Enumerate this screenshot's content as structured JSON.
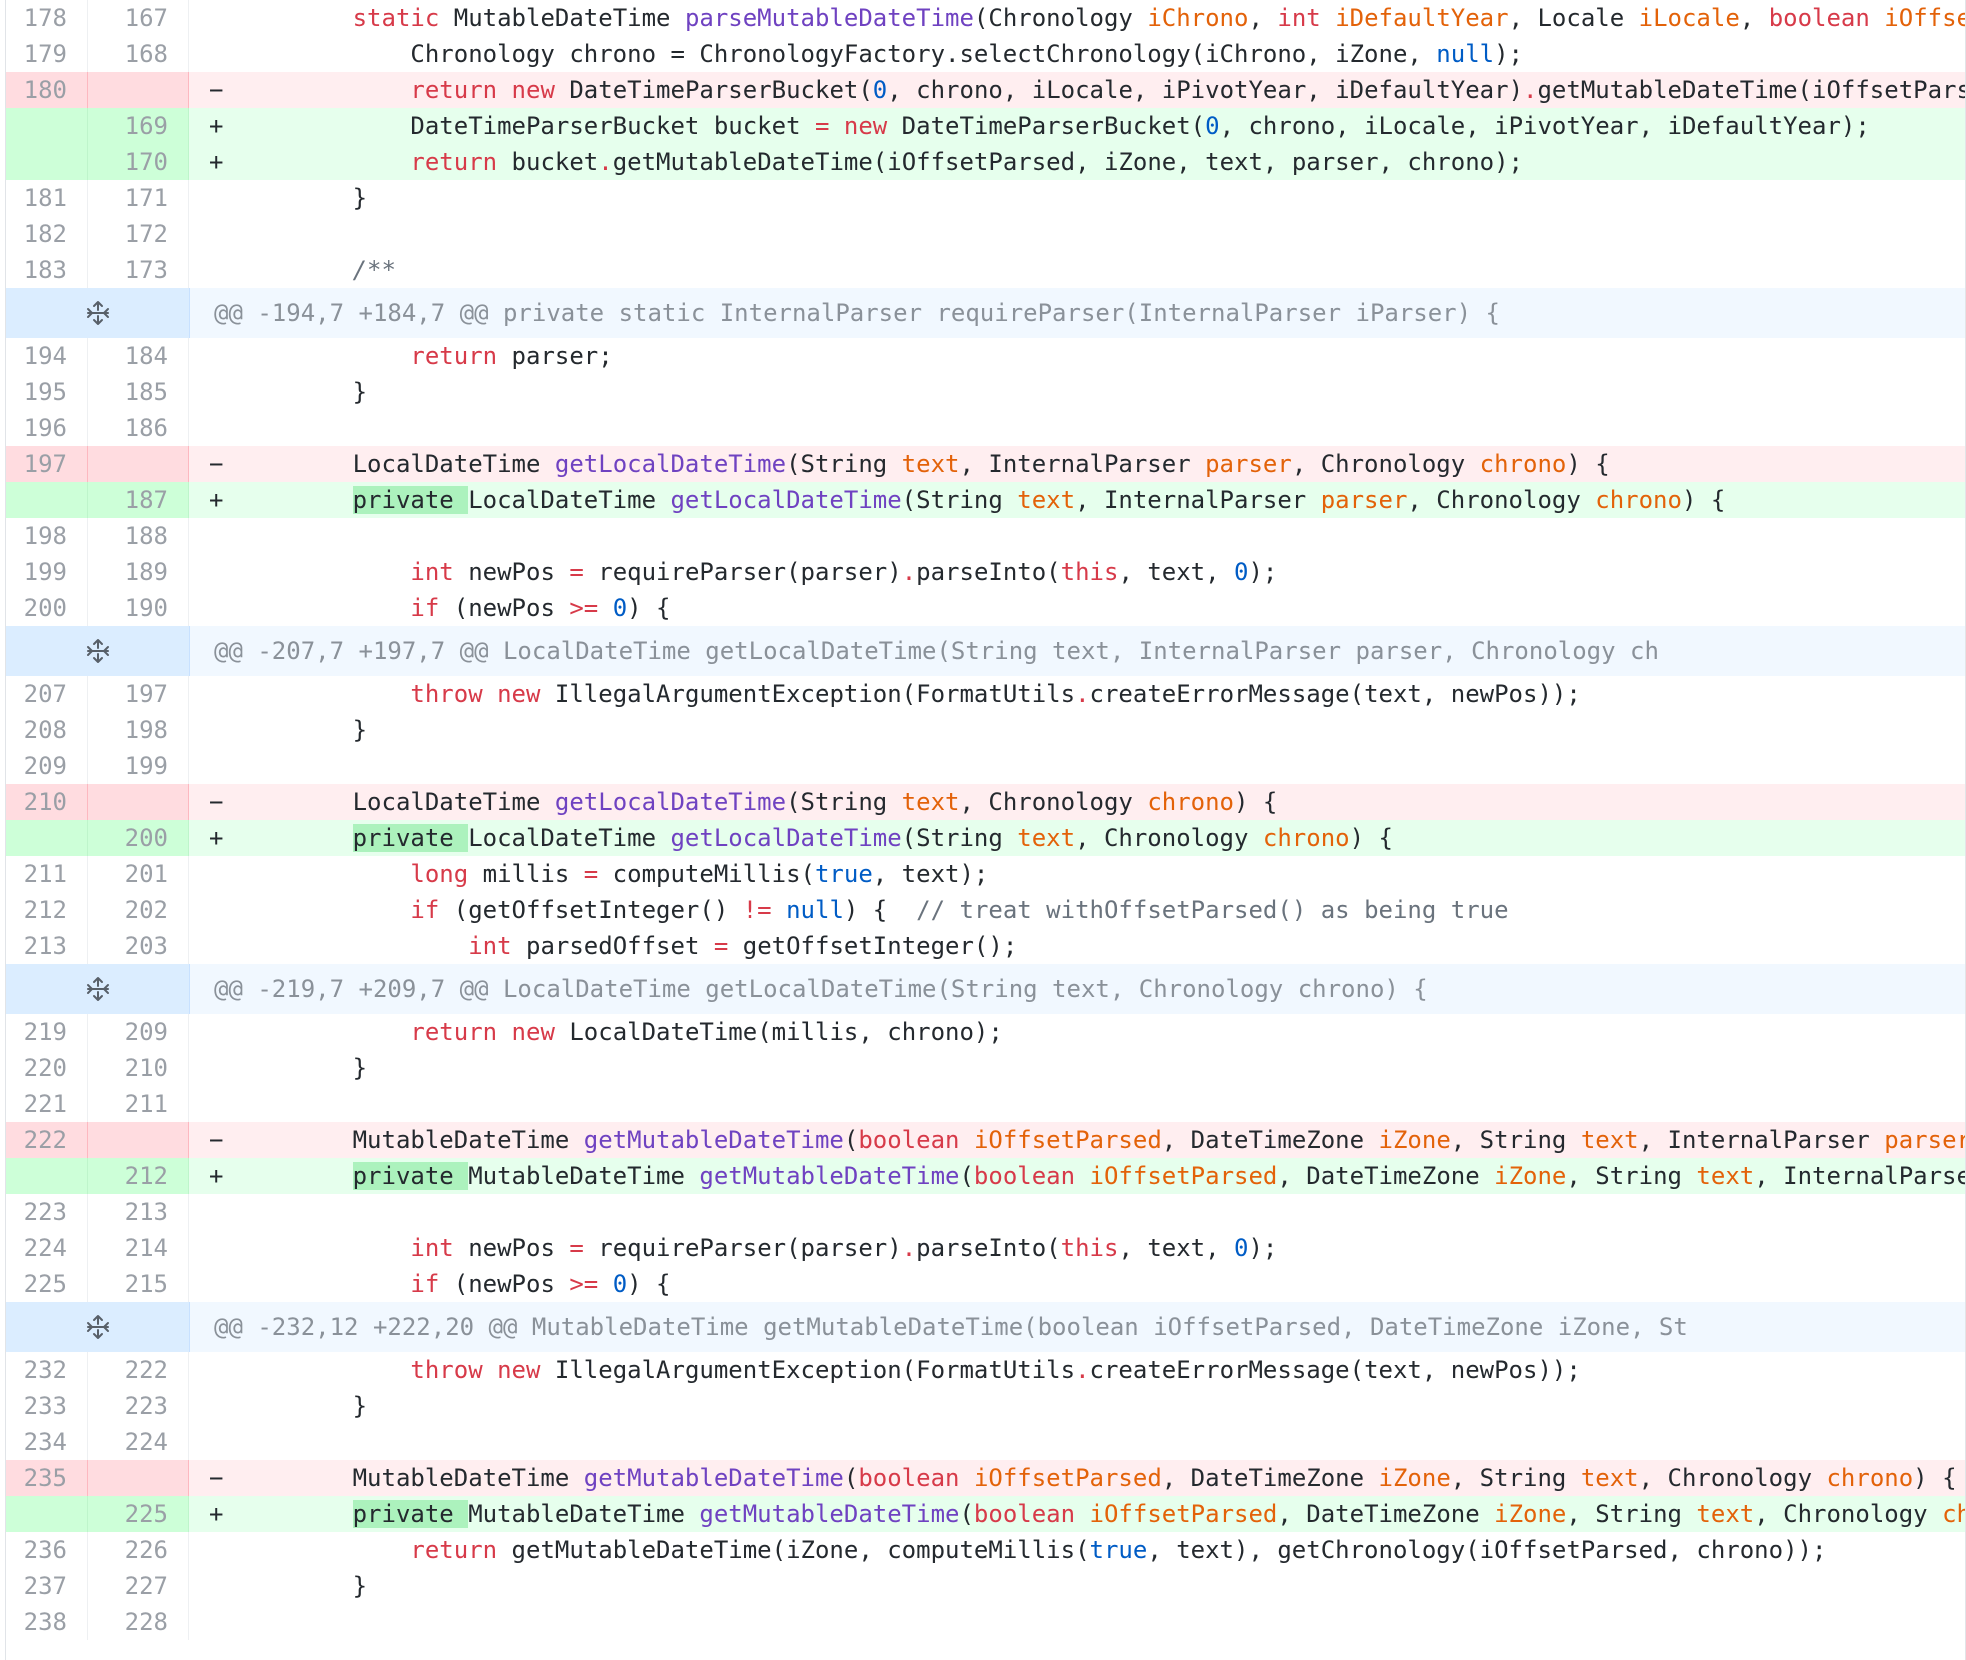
{
  "diff": {
    "rows": [
      {
        "type": "ctx",
        "old": "178",
        "new": "167",
        "code": "        ${kw:static} MutableDateTime ${fn:parseMutableDateTime}(Chronology ${pa:iChrono}, ${kw:int} ${pa:iDefaultYear}, Locale ${pa:iLocale}, ${kw:boolean} ${pa:iOffsetPars}"
      },
      {
        "type": "ctx",
        "old": "179",
        "new": "168",
        "code": "            Chronology chrono = ChronologyFactory.selectChronology(iChrono, iZone, ${cn:null});"
      },
      {
        "type": "del",
        "old": "180",
        "new": "",
        "code": "            ${kw:return} ${kw:new} DateTimeParserBucket(${cn:0}, chrono, iLocale, iPivotYear, iDefaultYear)${kw:.}getMutableDateTime(iOffsetParsed, i"
      },
      {
        "type": "add",
        "old": "",
        "new": "169",
        "code": "            DateTimeParserBucket bucket ${kw:=} ${kw:new} DateTimeParserBucket(${cn:0}, chrono, iLocale, iPivotYear, iDefaultYear);"
      },
      {
        "type": "add",
        "old": "",
        "new": "170",
        "code": "            ${kw:return} bucket${kw:.}getMutableDateTime(iOffsetParsed, iZone, text, parser, chrono);"
      },
      {
        "type": "ctx",
        "old": "181",
        "new": "171",
        "code": "        }"
      },
      {
        "type": "ctx",
        "old": "182",
        "new": "172",
        "code": ""
      },
      {
        "type": "ctx",
        "old": "183",
        "new": "173",
        "code": "        ${cm:/**}"
      },
      {
        "type": "hunk",
        "text": "@@ -194,7 +184,7 @@ private static InternalParser requireParser(InternalParser iParser) {"
      },
      {
        "type": "ctx",
        "old": "194",
        "new": "184",
        "code": "            ${kw:return} parser;"
      },
      {
        "type": "ctx",
        "old": "195",
        "new": "185",
        "code": "        }"
      },
      {
        "type": "ctx",
        "old": "196",
        "new": "186",
        "code": ""
      },
      {
        "type": "del",
        "old": "197",
        "new": "",
        "code": "        LocalDateTime ${fn:getLocalDateTime}(String ${pa:text}, InternalParser ${pa:parser}, Chronology ${pa:chrono}) {"
      },
      {
        "type": "add",
        "old": "",
        "new": "187",
        "code": "        ${hl:private }LocalDateTime ${fn:getLocalDateTime}(String ${pa:text}, InternalParser ${pa:parser}, Chronology ${pa:chrono}) {"
      },
      {
        "type": "ctx",
        "old": "198",
        "new": "188",
        "code": ""
      },
      {
        "type": "ctx",
        "old": "199",
        "new": "189",
        "code": "            ${kw:int} newPos ${kw:=} requireParser(parser)${kw:.}parseInto(${kw:this}, text, ${cn:0});"
      },
      {
        "type": "ctx",
        "old": "200",
        "new": "190",
        "code": "            ${kw:if} (newPos ${kw:>=} ${cn:0}) {"
      },
      {
        "type": "hunk",
        "text": "@@ -207,7 +197,7 @@ LocalDateTime getLocalDateTime(String text, InternalParser parser, Chronology ch"
      },
      {
        "type": "ctx",
        "old": "207",
        "new": "197",
        "code": "            ${kw:throw} ${kw:new} IllegalArgumentException(FormatUtils${kw:.}createErrorMessage(text, newPos));"
      },
      {
        "type": "ctx",
        "old": "208",
        "new": "198",
        "code": "        }"
      },
      {
        "type": "ctx",
        "old": "209",
        "new": "199",
        "code": ""
      },
      {
        "type": "del",
        "old": "210",
        "new": "",
        "code": "        LocalDateTime ${fn:getLocalDateTime}(String ${pa:text}, Chronology ${pa:chrono}) {"
      },
      {
        "type": "add",
        "old": "",
        "new": "200",
        "code": "        ${hl:private }LocalDateTime ${fn:getLocalDateTime}(String ${pa:text}, Chronology ${pa:chrono}) {"
      },
      {
        "type": "ctx",
        "old": "211",
        "new": "201",
        "code": "            ${kw:long} millis ${kw:=} computeMillis(${cn:true}, text);"
      },
      {
        "type": "ctx",
        "old": "212",
        "new": "202",
        "code": "            ${kw:if} (getOffsetInteger() ${kw:!=} ${cn:null}) {  ${cm2:// treat withOffsetParsed() as being true}"
      },
      {
        "type": "ctx",
        "old": "213",
        "new": "203",
        "code": "                ${kw:int} parsedOffset ${kw:=} getOffsetInteger();"
      },
      {
        "type": "hunk",
        "text": "@@ -219,7 +209,7 @@ LocalDateTime getLocalDateTime(String text, Chronology chrono) {"
      },
      {
        "type": "ctx",
        "old": "219",
        "new": "209",
        "code": "            ${kw:return} ${kw:new} LocalDateTime(millis, chrono);"
      },
      {
        "type": "ctx",
        "old": "220",
        "new": "210",
        "code": "        }"
      },
      {
        "type": "ctx",
        "old": "221",
        "new": "211",
        "code": ""
      },
      {
        "type": "del",
        "old": "222",
        "new": "",
        "code": "        MutableDateTime ${fn:getMutableDateTime}(${kw:boolean} ${pa:iOffsetParsed}, DateTimeZone ${pa:iZone}, String ${pa:text}, InternalParser ${pa:parser}, Chr"
      },
      {
        "type": "add",
        "old": "",
        "new": "212",
        "code": "        ${hl:private }MutableDateTime ${fn:getMutableDateTime}(${kw:boolean} ${pa:iOffsetParsed}, DateTimeZone ${pa:iZone}, String ${pa:text}, InternalParser ${pa:par}"
      },
      {
        "type": "ctx",
        "old": "223",
        "new": "213",
        "code": ""
      },
      {
        "type": "ctx",
        "old": "224",
        "new": "214",
        "code": "            ${kw:int} newPos ${kw:=} requireParser(parser)${kw:.}parseInto(${kw:this}, text, ${cn:0});"
      },
      {
        "type": "ctx",
        "old": "225",
        "new": "215",
        "code": "            ${kw:if} (newPos ${kw:>=} ${cn:0}) {"
      },
      {
        "type": "hunk",
        "text": "@@ -232,12 +222,20 @@ MutableDateTime getMutableDateTime(boolean iOffsetParsed, DateTimeZone iZone, St"
      },
      {
        "type": "ctx",
        "old": "232",
        "new": "222",
        "code": "            ${kw:throw} ${kw:new} IllegalArgumentException(FormatUtils${kw:.}createErrorMessage(text, newPos));"
      },
      {
        "type": "ctx",
        "old": "233",
        "new": "223",
        "code": "        }"
      },
      {
        "type": "ctx",
        "old": "234",
        "new": "224",
        "code": ""
      },
      {
        "type": "del",
        "old": "235",
        "new": "",
        "code": "        MutableDateTime ${fn:getMutableDateTime}(${kw:boolean} ${pa:iOffsetParsed}, DateTimeZone ${pa:iZone}, String ${pa:text}, Chronology ${pa:chrono}) {"
      },
      {
        "type": "add",
        "old": "",
        "new": "225",
        "code": "        ${hl:private }MutableDateTime ${fn:getMutableDateTime}(${kw:boolean} ${pa:iOffsetParsed}, DateTimeZone ${pa:iZone}, String ${pa:text}, Chronology ${pa:chrono})"
      },
      {
        "type": "ctx",
        "old": "236",
        "new": "226",
        "code": "            ${kw:return} getMutableDateTime(iZone, computeMillis(${cn:true}, text), getChronology(iOffsetParsed, chrono));"
      },
      {
        "type": "ctx",
        "old": "237",
        "new": "227",
        "code": "        }"
      },
      {
        "type": "ctx",
        "old": "238",
        "new": "228",
        "code": ""
      }
    ]
  },
  "colors": {
    "keyword": "#d73a49",
    "function": "#6f42c1",
    "param": "#e36209",
    "constant": "#005cc5",
    "deleted_bg": "#ffeef0",
    "added_bg": "#e6ffed",
    "hunk_bg": "#f1f8ff"
  },
  "icons": {
    "expand": "unfold-icon"
  }
}
